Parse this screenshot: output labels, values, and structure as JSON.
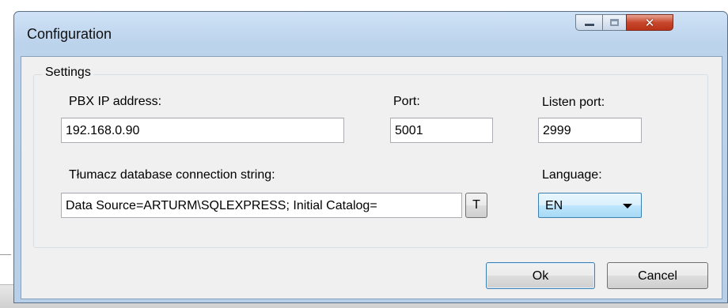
{
  "window": {
    "title": "Configuration",
    "caption_buttons": {
      "minimize": "minimize-icon",
      "maximize": "maximize-icon",
      "close": "close-icon"
    }
  },
  "settings": {
    "group_label": "Settings",
    "pbx_ip": {
      "label": "PBX IP address:",
      "value": "192.168.0.90"
    },
    "port": {
      "label": "Port:",
      "value": "5001"
    },
    "listen_port": {
      "label": "Listen port:",
      "value": "2999"
    },
    "connection_string": {
      "label": "Tłumacz database connection string:",
      "value": "Data Source=ARTURM\\SQLEXPRESS; Initial Catalog=",
      "button_label": "T"
    },
    "language": {
      "label": "Language:",
      "selected": "EN"
    }
  },
  "buttons": {
    "ok": "Ok",
    "cancel": "Cancel"
  }
}
